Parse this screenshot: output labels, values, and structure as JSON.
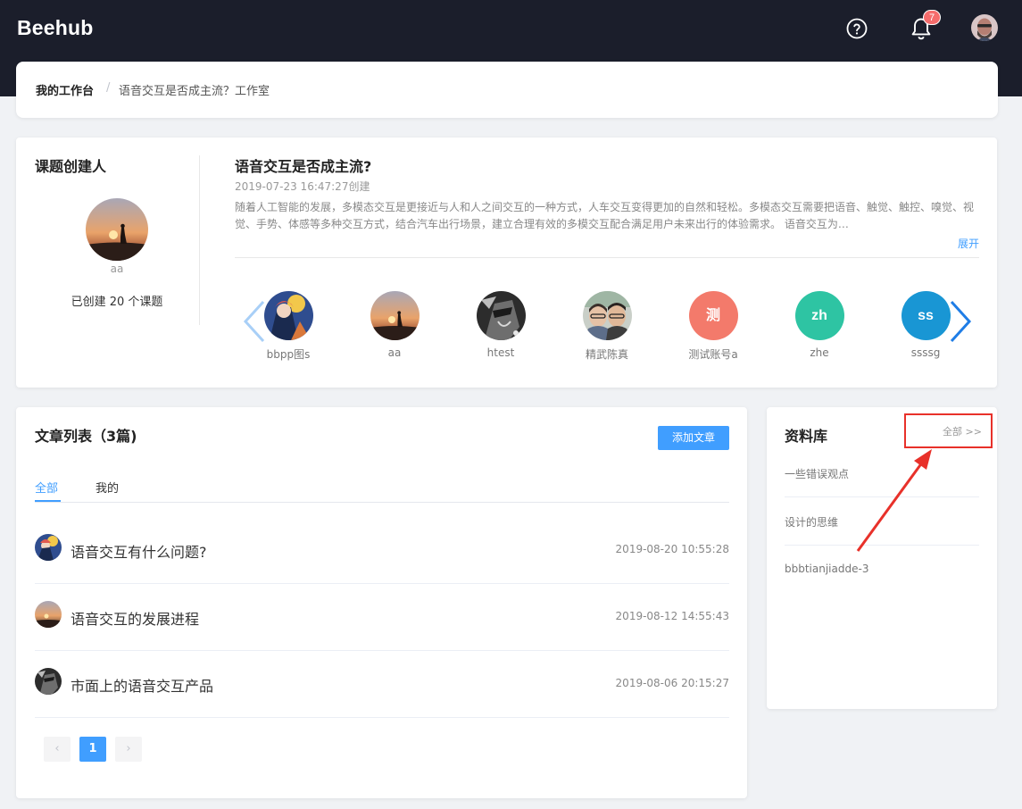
{
  "header": {
    "logo": "Beehub",
    "notification_count": "7",
    "icons": {
      "help": "help-circle-icon",
      "bell": "bell-icon",
      "avatar": "user-avatar"
    }
  },
  "breadcrumb": {
    "home": "我的工作台",
    "separator": "/",
    "current": "语音交互是否成主流？工作室"
  },
  "creator": {
    "section_title": "课题创建人",
    "name": "aa",
    "created_count": "已创建 20 个课题"
  },
  "topic": {
    "title": "语音交互是否成主流?",
    "created_at": "2019-07-23 16:47:27创建",
    "description": "随着人工智能的发展，多模态交互是更接近与人和人之间交互的一种方式，人车交互变得更加的自然和轻松。多模态交互需要把语音、触觉、触控、嗅觉、视觉、手势、体感等多种交互方式，结合汽车出行场景，建立合理有效的多模交互配合满足用户未来出行的体验需求。 语音交互为…",
    "expand": "展开"
  },
  "members": [
    {
      "name": "bbpp图s",
      "initials": ""
    },
    {
      "name": "aa",
      "initials": ""
    },
    {
      "name": "htest",
      "initials": ""
    },
    {
      "name": "精武陈真",
      "initials": ""
    },
    {
      "name": "测试账号a",
      "initials": "测"
    },
    {
      "name": "zhe",
      "initials": "zh"
    },
    {
      "name": "ssssg",
      "initials": "ss"
    }
  ],
  "member_colors": {
    "测试账号a": "#f37a6b",
    "zhe": "#2ec4a3",
    "ssssg": "#1996d4"
  },
  "articles": {
    "title": "文章列表（3篇)",
    "add_button": "添加文章",
    "tabs": [
      "全部",
      "我的"
    ],
    "items": [
      {
        "title": "语音交互有什么问题?",
        "date": "2019-08-20 10:55:28"
      },
      {
        "title": "语音交互的发展进程",
        "date": "2019-08-12 14:55:43"
      },
      {
        "title": "市面上的语音交互产品",
        "date": "2019-08-06 20:15:27"
      }
    ],
    "pagination": {
      "prev": "‹",
      "page": "1",
      "next": "›"
    }
  },
  "library": {
    "title": "资料库",
    "all_link": "全部 >>",
    "items": [
      "一些错误观点",
      "设计的思维",
      "bbbtianjiadde-3"
    ]
  },
  "colors": {
    "accent": "#409eff",
    "topbar": "#1b1e2b",
    "annotation": "#e8312a"
  }
}
